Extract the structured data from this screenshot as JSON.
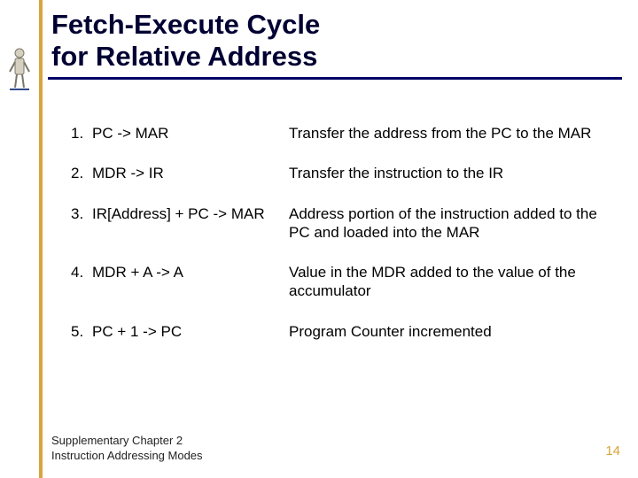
{
  "title_line1": "Fetch-Execute Cycle",
  "title_line2": "for Relative Address",
  "steps": [
    {
      "num": "1.",
      "op": "PC -> MAR",
      "desc": "Transfer the address from the PC to the MAR"
    },
    {
      "num": "2.",
      "op": "MDR -> IR",
      "desc": "Transfer the instruction to the IR"
    },
    {
      "num": "3.",
      "op": "IR[Address] + PC -> MAR",
      "desc": "Address portion of the instruction added to the PC and loaded into the MAR"
    },
    {
      "num": "4.",
      "op": "MDR + A -> A",
      "desc": "Value in the MDR added to the value of the accumulator"
    },
    {
      "num": "5.",
      "op": "PC + 1 -> PC",
      "desc": "Program Counter incremented"
    }
  ],
  "footer_line1": "Supplementary Chapter 2",
  "footer_line2": "Instruction Addressing Modes",
  "page_number": "14"
}
